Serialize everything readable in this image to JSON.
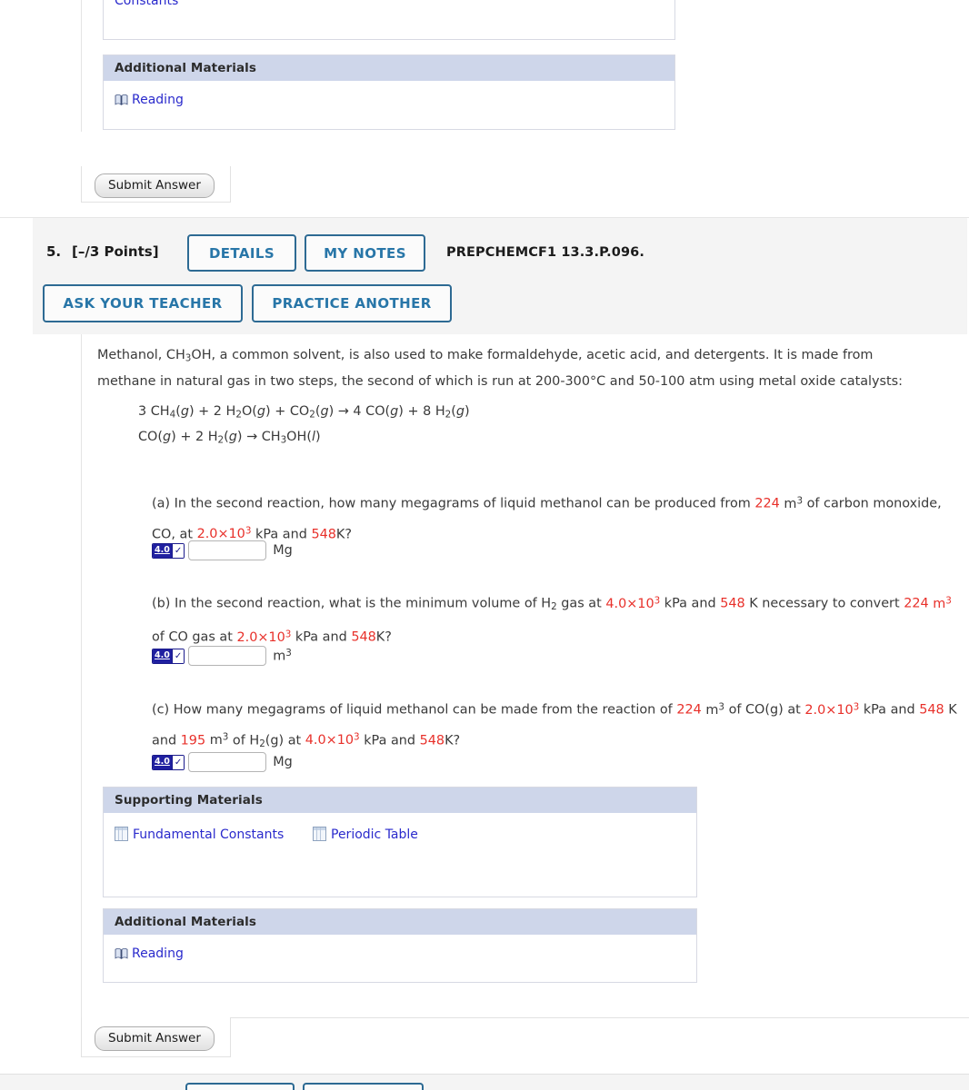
{
  "prev_question": {
    "supporting_materials_tail": "Constants",
    "additional_materials": {
      "title": "Additional Materials",
      "links": [
        {
          "label": "Reading",
          "icon": "book-icon"
        }
      ]
    },
    "submit_label": "Submit Answer"
  },
  "question": {
    "number": "5.",
    "points": "[–/3 Points]",
    "buttons": [
      {
        "id": "details",
        "label": "DETAILS"
      },
      {
        "id": "my-notes",
        "label": "MY NOTES"
      },
      {
        "id": "ask-your-teacher",
        "label": "ASK YOUR TEACHER"
      },
      {
        "id": "practice-another",
        "label": "PRACTICE ANOTHER"
      }
    ],
    "code": "PREPCHEMCF1 13.3.P.096.",
    "stem_line1_a": "Methanol, CH",
    "stem_line1_b": "OH, a common solvent, is also used to make formaldehyde, acetic acid, and detergents. It is made from",
    "stem_line1_sub": "3",
    "stem_line2": "methane in natural gas in two steps, the second of which is run at 200-300°C and 50-100 atm using metal oxide catalysts:",
    "equations": [
      "3 CH4(g) + 2 H2O(g) + CO2(g) → 4 CO(g) + 8 H2(g)",
      "CO(g) + 2 H2(g) → CH3OH(l)"
    ],
    "parts": [
      {
        "label": "(a)",
        "text_before": "In the second reaction, how many megagrams of liquid methanol can be produced from",
        "v1": "224",
        "unit_after_v1": "m",
        "unit_exp": "3",
        "text_mid": "of carbon monoxide, CO, at",
        "v2": "2.0×10",
        "v2_exp": "3",
        "unit2": "kPa and",
        "v3": "548",
        "tail": "K?",
        "answer_value": "",
        "answer_unit": "Mg",
        "badge_num": "4.0",
        "badge_check": "✓"
      },
      {
        "label": "(b)",
        "text_before": "In the second reaction, what is the minimum volume of H",
        "h_sub": "2",
        "text_before2": "gas at",
        "v1": "4.0×10",
        "v1_exp": "3",
        "unit1": "kPa and",
        "v2": "548",
        "text_mid": "K necessary to convert",
        "v3": "224",
        "unit2": "m",
        "unit2_exp": "3",
        "text_mid2": "of CO gas at",
        "v4": "2.0×10",
        "v4_exp": "3",
        "unit3": "kPa and",
        "v5": "548",
        "tail": "K?",
        "answer_value": "",
        "answer_unit": "m",
        "answer_unit_exp": "3",
        "badge_num": "4.0",
        "badge_check": "✓"
      },
      {
        "label": "(c)",
        "text_before": "How many megagrams of liquid methanol can be made from the reaction of",
        "v1": "224",
        "unit1": "m",
        "unit1_exp": "3",
        "text_mid": "of CO(g) at",
        "v2": "2.0×10",
        "v2_exp": "3",
        "unit2": "kPa and",
        "v3": "548",
        "text_mid2": "K and",
        "v4": "195",
        "unit3": "m",
        "unit3_exp": "3",
        "text_mid3": "of H",
        "h_sub": "2",
        "text_mid4": "(g) at",
        "v5": "4.0×10",
        "v5_exp": "3",
        "unit4": "kPa and",
        "v6": "548",
        "tail": "K?",
        "answer_value": "",
        "answer_unit": "Mg",
        "badge_num": "4.0",
        "badge_check": "✓"
      }
    ],
    "supporting_materials": {
      "title": "Supporting Materials",
      "links": [
        {
          "label": "Fundamental Constants",
          "icon": "table-icon"
        },
        {
          "label": "Periodic Table",
          "icon": "table-icon"
        }
      ]
    },
    "additional_materials": {
      "title": "Additional Materials",
      "links": [
        {
          "label": "Reading",
          "icon": "book-icon"
        }
      ]
    },
    "submit_label": "Submit Answer"
  },
  "colors": {
    "accent_blue": "#2876a8",
    "border_blue": "#2d6a93",
    "link_blue": "#2a2acc",
    "value_red": "#e8302a",
    "panel_header": "#ced6ea",
    "header_bg": "#f4f4f4"
  }
}
